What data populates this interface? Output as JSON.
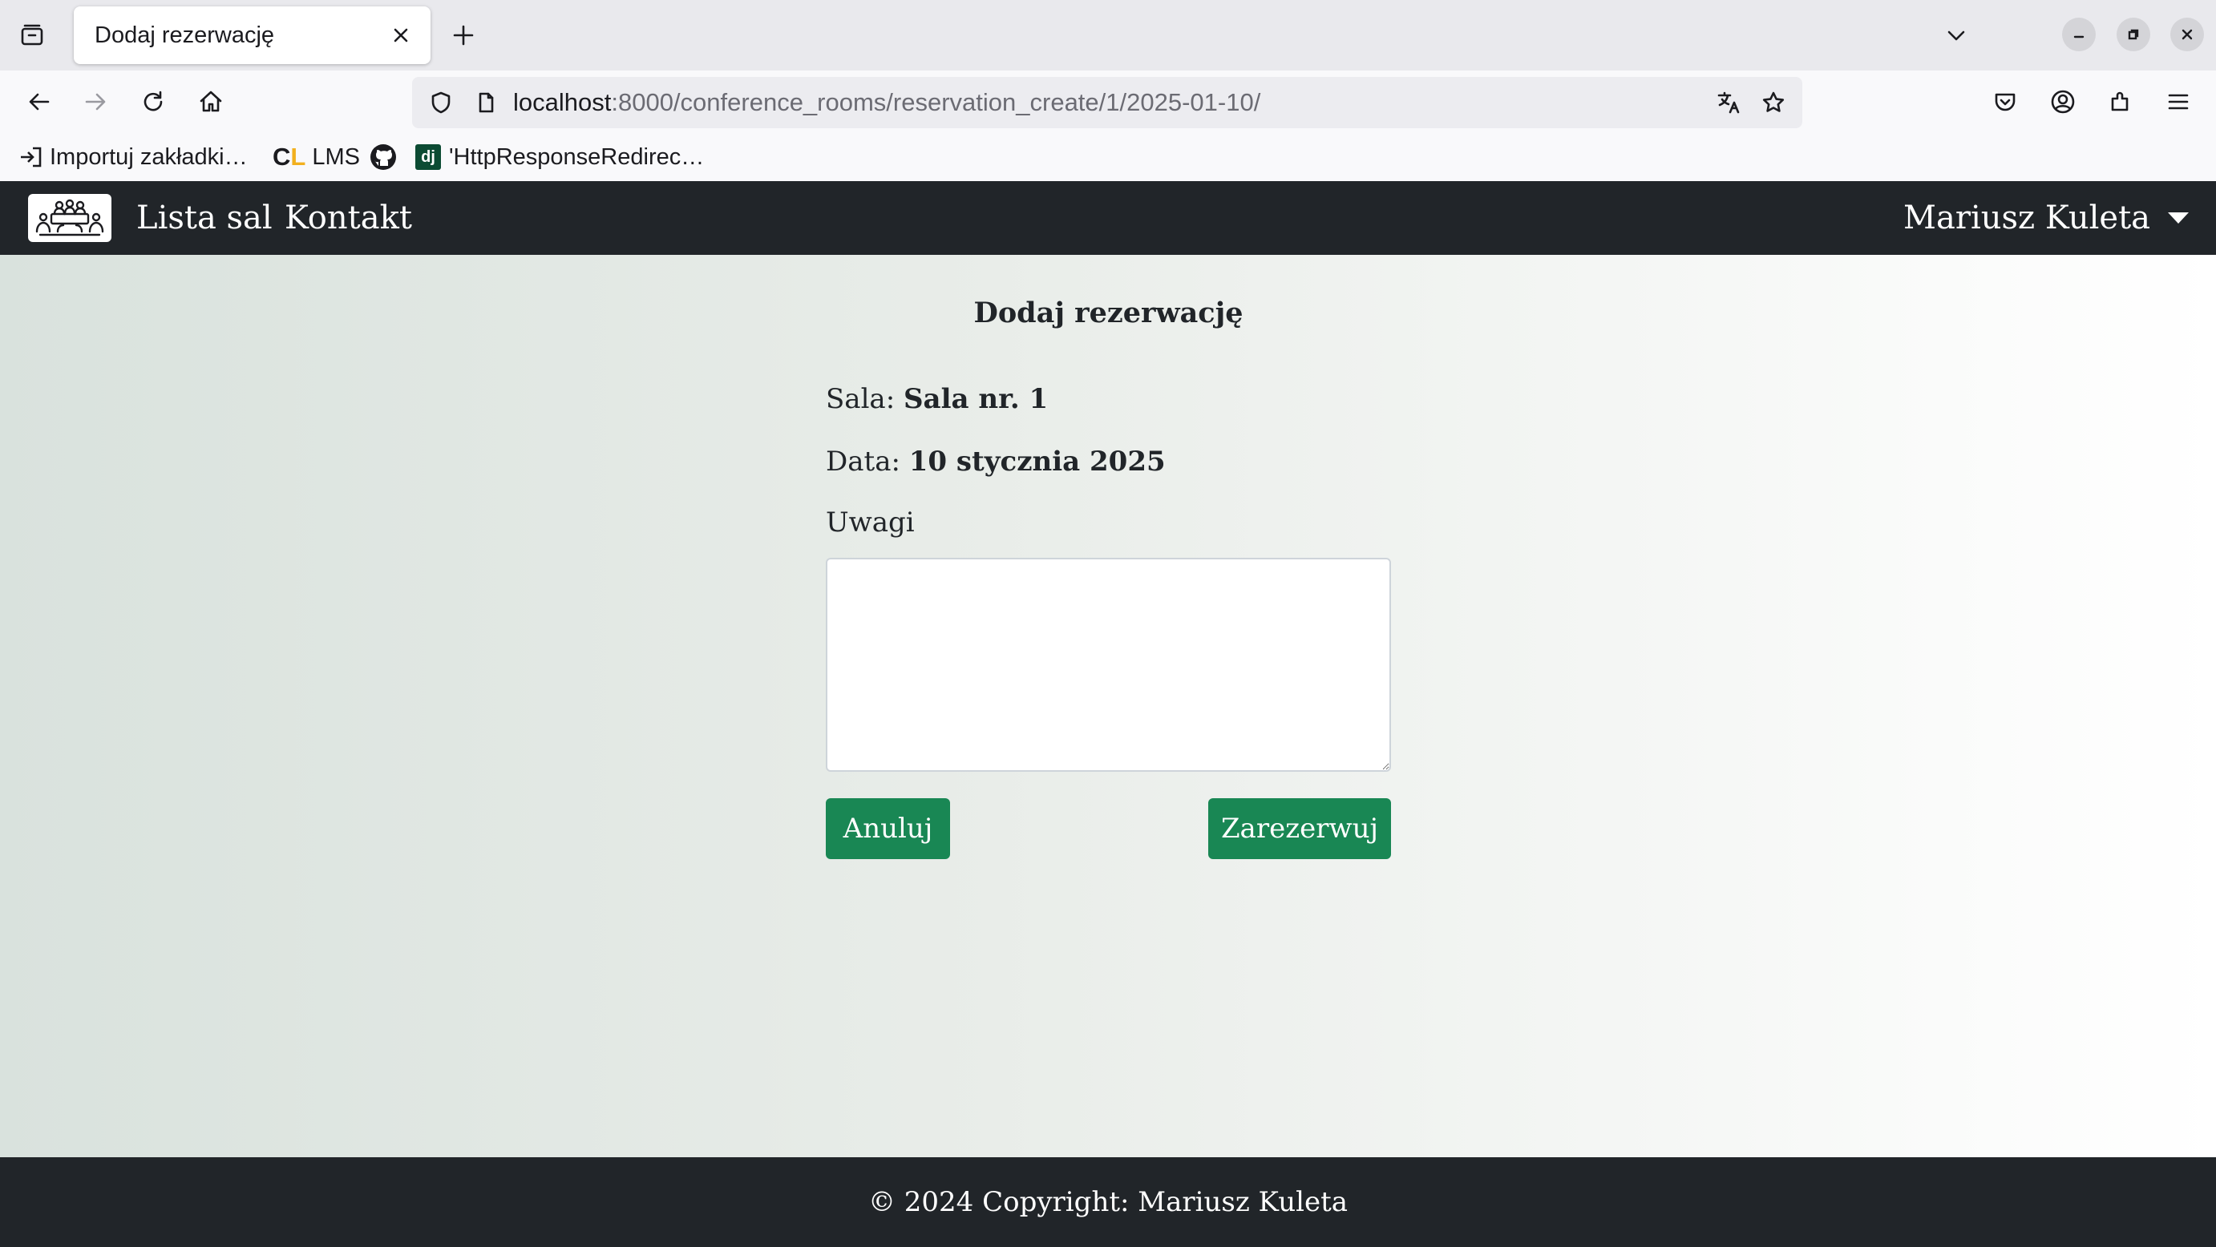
{
  "browser": {
    "tab_title": "Dodaj rezerwację",
    "url_host": "localhost",
    "url_path": ":8000/conference_rooms/reservation_create/1/2025-01-10/",
    "bookmarks": [
      {
        "label": "Importuj zakładki…",
        "icon": "import-icon"
      },
      {
        "label": "LMS",
        "icon": "cl-logo-icon"
      },
      {
        "label": "",
        "icon": "github-icon"
      },
      {
        "label": "'HttpResponseRedirec…",
        "icon": "django-icon"
      }
    ]
  },
  "site_nav": {
    "links": [
      "Lista sal",
      "Kontakt"
    ],
    "user_name": "Mariusz Kuleta"
  },
  "form": {
    "title": "Dodaj rezerwację",
    "room_label": "Sala:",
    "room_value": "Sala nr. 1",
    "date_label": "Data:",
    "date_value": "10 stycznia 2025",
    "notes_label": "Uwagi",
    "notes_value": "",
    "cancel_label": "Anuluj",
    "reserve_label": "Zarezerwuj"
  },
  "footer": {
    "text": "© 2024 Copyright: Mariusz Kuleta"
  },
  "colors": {
    "navbar_bg": "#212529",
    "button_green": "#198754",
    "footer_bg": "#212529"
  }
}
